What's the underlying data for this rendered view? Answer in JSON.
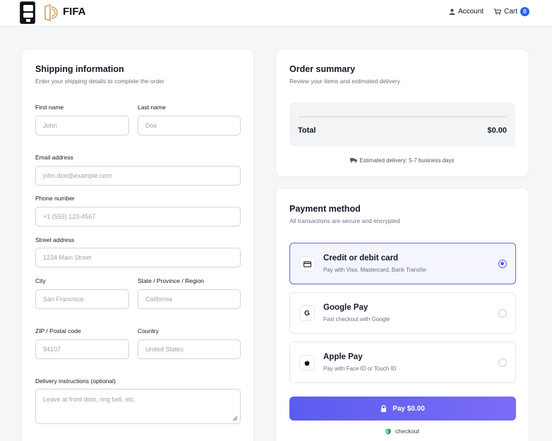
{
  "header": {
    "brand": "FIFA",
    "account_label": "Account",
    "cart_label": "Cart",
    "cart_count": "0",
    "accent_color": "#2563eb"
  },
  "shipping": {
    "title": "Shipping information",
    "subtitle": "Enter your shipping details to complete the order",
    "first_name": {
      "label": "First name",
      "placeholder": "John"
    },
    "last_name": {
      "label": "Last name",
      "placeholder": "Doe"
    },
    "email": {
      "label": "Email address",
      "placeholder": "john.doe@example.com"
    },
    "phone": {
      "label": "Phone number",
      "placeholder": "+1 (555) 123-4567"
    },
    "street": {
      "label": "Street address",
      "placeholder": "1234 Main Street"
    },
    "city": {
      "label": "City",
      "placeholder": "San Francisco"
    },
    "state": {
      "label": "State / Province / Region",
      "placeholder": "California"
    },
    "zip": {
      "label": "ZIP / Postal code",
      "placeholder": "94107"
    },
    "country": {
      "label": "Country",
      "placeholder": "United States"
    },
    "instructions": {
      "label": "Delivery instructions (optional)",
      "placeholder": "Leave at front door, ring bell, etc."
    }
  },
  "summary": {
    "title": "Order summary",
    "subtitle": "Review your items and estimated delivery",
    "total_label": "Total",
    "total_value": "$0.00",
    "delivery_text": "Estimated delivery: 5-7 business days"
  },
  "payment": {
    "title": "Payment method",
    "subtitle": "All transactions are secure and encrypted",
    "options": [
      {
        "name": "Credit or debit card",
        "desc": "Pay with Visa, Mastercard, Bank Transfer",
        "icon": "credit-card-icon",
        "selected": true
      },
      {
        "name": "Google Pay",
        "desc": "Fast checkout with Google",
        "icon": "google-icon",
        "icon_text": "G",
        "selected": false
      },
      {
        "name": "Apple Pay",
        "desc": "Pay with Face ID or Touch ID",
        "icon": "apple-icon",
        "selected": false
      }
    ],
    "pay_button": "Pay $0.00",
    "secure_note": "checkout",
    "button_color": "#5b5cf0",
    "secure_color": "#16a34a"
  }
}
